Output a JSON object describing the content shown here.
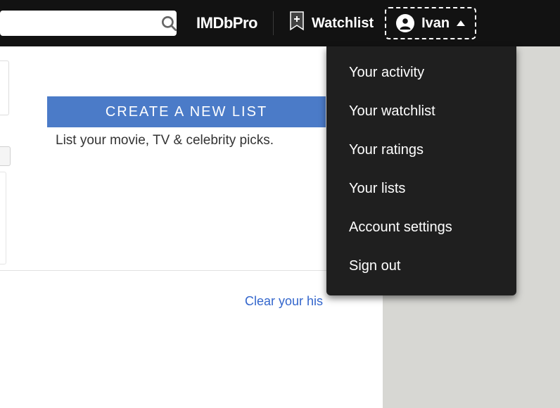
{
  "header": {
    "search_placeholder": "",
    "pro_logo": "IMDbPro",
    "watchlist_label": "Watchlist",
    "user_name": "Ivan"
  },
  "content": {
    "create_button": "CREATE A NEW LIST",
    "subtitle": "List your movie, TV & celebrity picks.",
    "clear_history": "Clear your his"
  },
  "menu": {
    "items": [
      "Your activity",
      "Your watchlist",
      "Your ratings",
      "Your lists",
      "Account settings",
      "Sign out"
    ]
  }
}
